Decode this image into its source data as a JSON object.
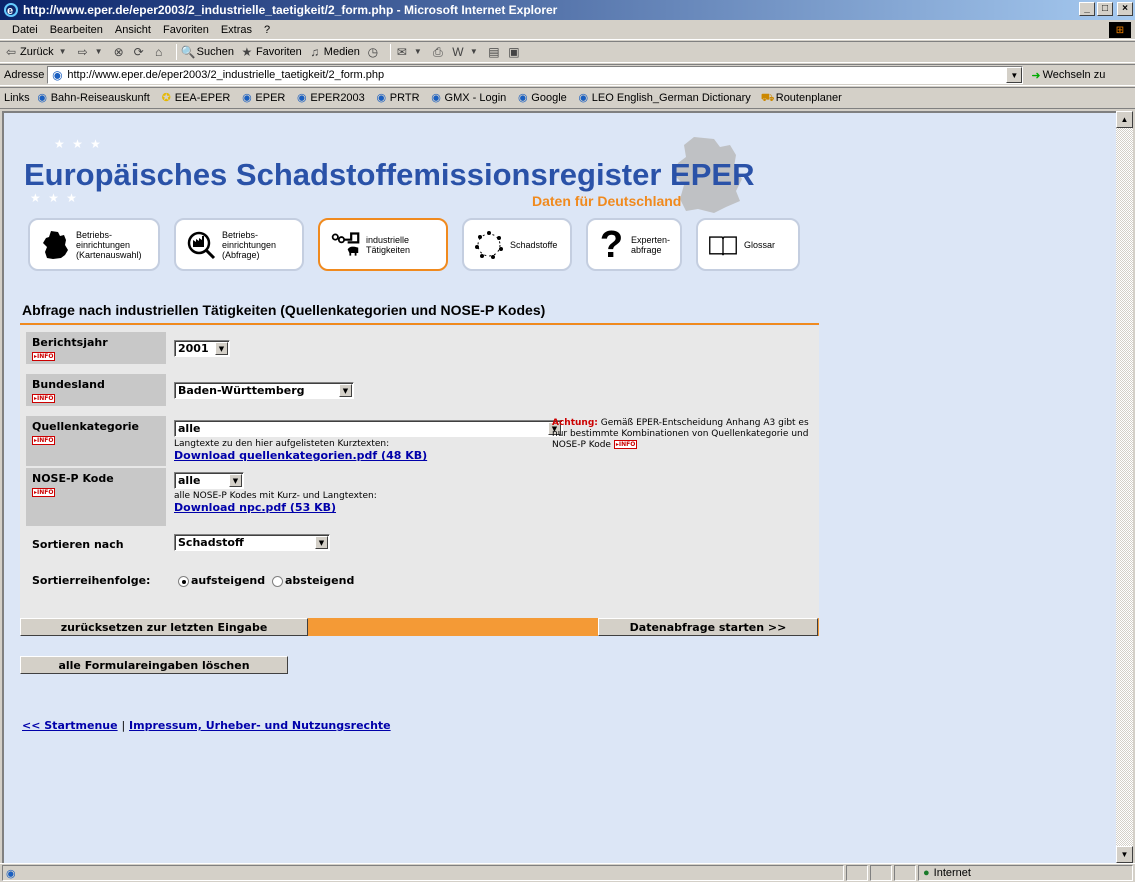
{
  "window": {
    "title": "http://www.eper.de/eper2003/2_industrielle_taetigkeit/2_form.php - Microsoft Internet Explorer",
    "controls": [
      "_",
      "□",
      "×"
    ]
  },
  "menu": [
    "Datei",
    "Bearbeiten",
    "Ansicht",
    "Favoriten",
    "Extras",
    "?"
  ],
  "toolbar": {
    "back": "Zurück",
    "search": "Suchen",
    "favorites": "Favoriten",
    "media": "Medien"
  },
  "address": {
    "label": "Adresse",
    "url": "http://www.eper.de/eper2003/2_industrielle_taetigkeit/2_form.php",
    "go": "Wechseln zu"
  },
  "links": {
    "label": "Links",
    "items": [
      "Bahn-Reiseauskunft",
      "EEA-EPER",
      "EPER",
      "EPER2003",
      "PRTR",
      "GMX - Login",
      "Google",
      "LEO English_German Dictionary",
      "Routenplaner"
    ]
  },
  "header": {
    "title": "Europäisches Schadstoffemissionsregister EPER",
    "subtitle": "Daten für Deutschland"
  },
  "nav": [
    {
      "label1": "Betriebs-",
      "label2": "einrichtungen",
      "label3": "(Kartenauswahl)"
    },
    {
      "label1": "Betriebs-",
      "label2": "einrichtungen",
      "label3": "(Abfrage)"
    },
    {
      "label1": "industrielle",
      "label2": "Tätigkeiten",
      "label3": ""
    },
    {
      "label1": "Schadstoffe",
      "label2": "",
      "label3": ""
    },
    {
      "label1": "Experten-",
      "label2": "abfrage",
      "label3": ""
    },
    {
      "label1": "Glossar",
      "label2": "",
      "label3": ""
    }
  ],
  "page": {
    "title": "Abfrage nach industriellen Tätigkeiten (Quellenkategorien und NOSE-P Kodes)"
  },
  "form": {
    "info_badge": "INFO",
    "year": {
      "label": "Berichtsjahr",
      "value": "2001"
    },
    "state": {
      "label": "Bundesland",
      "value": "Baden-Württemberg"
    },
    "source": {
      "label": "Quellenkategorie",
      "value": "alle",
      "hint": "Langtexte zu den hier aufgelisteten Kurztexten:",
      "download": "Download quellenkategorien.pdf (48 KB)"
    },
    "nose": {
      "label": "NOSE-P Kode",
      "value": "alle",
      "hint": "alle NOSE-P Kodes mit Kurz- und Langtexten:",
      "download": "Download npc.pdf (53 KB)"
    },
    "sort": {
      "label": "Sortieren nach",
      "value": "Schadstoff"
    },
    "order": {
      "label": "Sortierreihenfolge:",
      "asc": "aufsteigend",
      "desc": "absteigend",
      "selected": "aufsteigend"
    },
    "warning": {
      "prefix": "Achtung:",
      "text": "Gemäß EPER-Entscheidung Anhang A3 gibt es nur bestimmte Kombinationen von Quellenkategorie und NOSE-P Kode"
    }
  },
  "buttons": {
    "reset": "zurücksetzen zur letzten Eingabe",
    "start": "Datenabfrage starten >>",
    "clear": "alle Formulareingaben löschen"
  },
  "footer": {
    "start": "<< Startmenue",
    "separator": "|",
    "impressum": "Impressum, Urheber- und Nutzungsrechte"
  },
  "status": {
    "zone": "Internet"
  }
}
